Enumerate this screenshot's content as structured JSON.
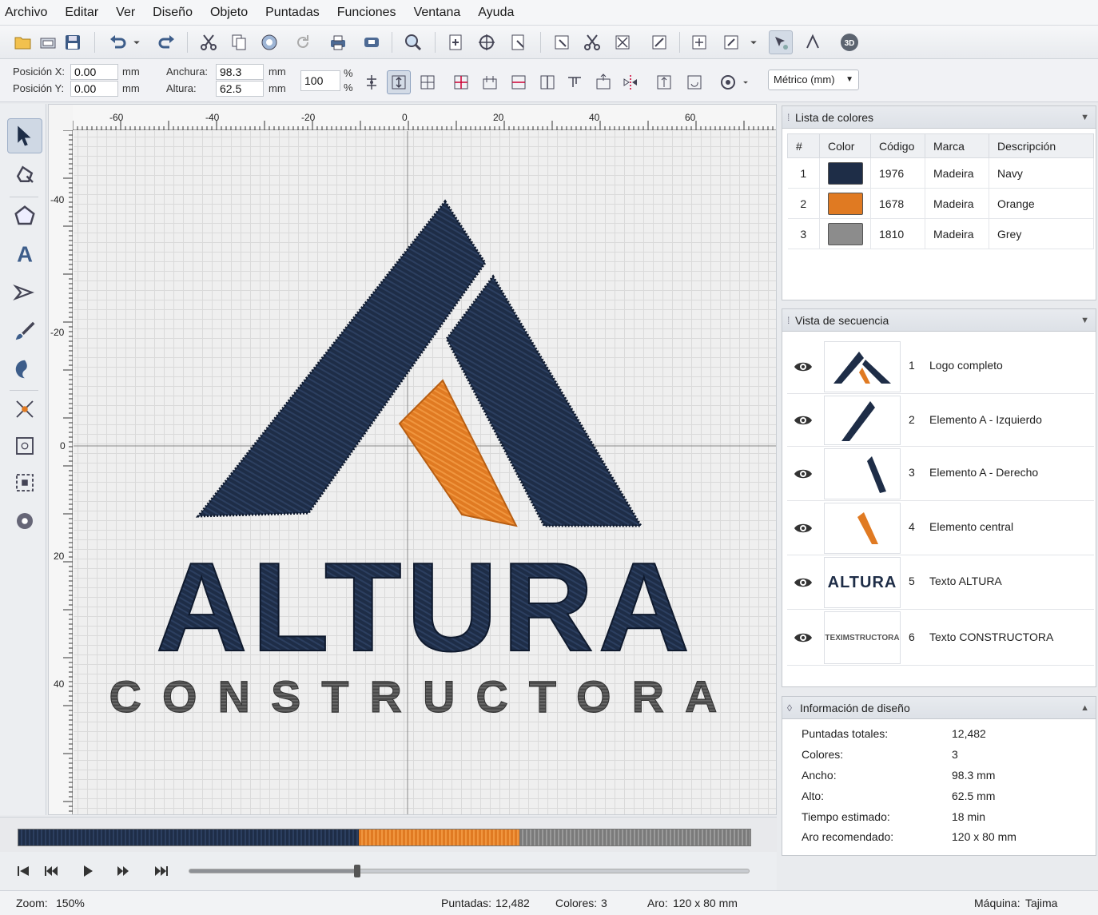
{
  "menu": [
    "Archivo",
    "Editar",
    "Ver",
    "Diseño",
    "Objeto",
    "Puntadas",
    "Funciones",
    "Ventana",
    "Ayuda"
  ],
  "props": {
    "pos_x_label": "Posición X:",
    "pos_x": "0.00",
    "pos_y_label": "Posición Y:",
    "pos_y": "0.00",
    "width_label": "Anchura:",
    "width": "98.3",
    "height_label": "Altura:",
    "height": "62.5",
    "unit_mm": "mm",
    "scale": "100",
    "percent": "%",
    "unit_select": "Métrico (mm)"
  },
  "rulers": {
    "top": [
      "-60",
      "-40",
      "-20",
      "0",
      "20",
      "40",
      "60"
    ],
    "left": [
      "-40",
      "-20",
      "0",
      "20",
      "40"
    ]
  },
  "design": {
    "title": "ALTURA",
    "subtitle": "CONSTRUCTORA"
  },
  "colors": {
    "navy": "#1e2d47",
    "orange": "#e07a22",
    "grey": "#888888"
  },
  "color_list": {
    "title": "Lista de colores",
    "headers": [
      "#",
      "Color",
      "Código",
      "Marca",
      "Descripción"
    ],
    "rows": [
      {
        "num": "1",
        "hex": "#1e2d47",
        "code": "1976",
        "brand": "Madeira",
        "desc": "Navy"
      },
      {
        "num": "2",
        "hex": "#e07a22",
        "code": "1678",
        "brand": "Madeira",
        "desc": "Orange"
      },
      {
        "num": "3",
        "hex": "#8c8c8c",
        "code": "1810",
        "brand": "Madeira",
        "desc": "Grey"
      }
    ]
  },
  "sequence": {
    "title": "Vista de secuencia",
    "items": [
      {
        "num": "1",
        "name": "Logo completo"
      },
      {
        "num": "2",
        "name": "Elemento A - Izquierdo"
      },
      {
        "num": "3",
        "name": "Elemento A - Derecho"
      },
      {
        "num": "4",
        "name": "Elemento central"
      },
      {
        "num": "5",
        "name": "Texto ALTURA",
        "thumb_text": "ALTURA"
      },
      {
        "num": "6",
        "name": "Texto CONSTRUCTORA",
        "thumb_text": "TEXIMSTRUCTORA"
      }
    ]
  },
  "info": {
    "title": "Información de diseño",
    "rows": [
      {
        "k": "Puntadas totales:",
        "v": "12,482"
      },
      {
        "k": "Colores:",
        "v": "3"
      },
      {
        "k": "Ancho:",
        "v": "98.3 mm"
      },
      {
        "k": "Alto:",
        "v": "62.5 mm"
      },
      {
        "k": "Tiempo estimado:",
        "v": "18 min"
      },
      {
        "k": "Aro recomendado:",
        "v": "120 x 80 mm"
      }
    ]
  },
  "stitch_segments": [
    0.465,
    0.22,
    0.315
  ],
  "player_progress": 0.3,
  "status": {
    "zoom_label": "Zoom:",
    "zoom": "150%",
    "stitches_label": "Puntadas:",
    "stitches": "12,482",
    "colors_label": "Colores:",
    "colors": "3",
    "hoop_label": "Aro:",
    "hoop": "120 x 80 mm",
    "machine_label": "Máquina:",
    "machine": "Tajima"
  }
}
